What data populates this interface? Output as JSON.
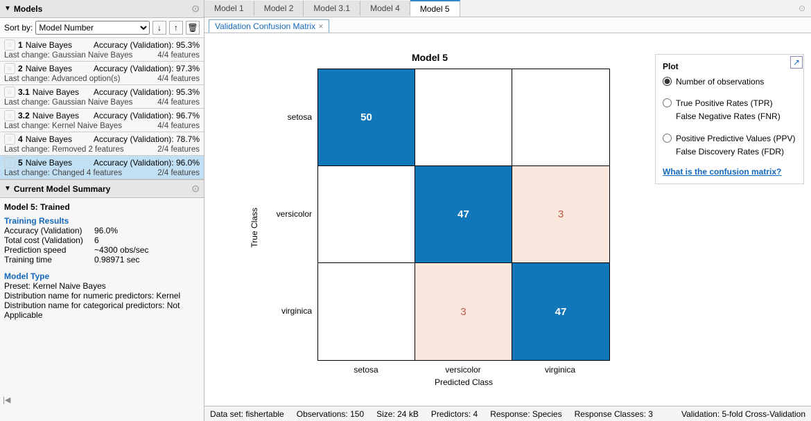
{
  "left": {
    "models_header": "Models",
    "sort_by": "Sort by:",
    "sort_value": "Model Number",
    "items": [
      {
        "num": "1",
        "name": "Naive Bayes",
        "acc": "Accuracy (Validation): 95.3%",
        "lc": "Last change: Gaussian Naive Bayes",
        "feat": "4/4 features",
        "selected": false
      },
      {
        "num": "2",
        "name": "Naive Bayes",
        "acc": "Accuracy (Validation): 97.3%",
        "lc": "Last change: Advanced option(s)",
        "feat": "4/4 features",
        "selected": false
      },
      {
        "num": "3.1",
        "name": "Naive Bayes",
        "acc": "Accuracy (Validation): 95.3%",
        "lc": "Last change: Gaussian Naive Bayes",
        "feat": "4/4 features",
        "selected": false
      },
      {
        "num": "3.2",
        "name": "Naive Bayes",
        "acc": "Accuracy (Validation): 96.7%",
        "lc": "Last change: Kernel Naive Bayes",
        "feat": "4/4 features",
        "selected": false
      },
      {
        "num": "4",
        "name": "Naive Bayes",
        "acc": "Accuracy (Validation): 78.7%",
        "lc": "Last change: Removed 2 features",
        "feat": "2/4 features",
        "selected": false
      },
      {
        "num": "5",
        "name": "Naive Bayes",
        "acc": "Accuracy (Validation): 96.0%",
        "lc": "Last change: Changed 4 features",
        "feat": "2/4 features",
        "selected": true
      }
    ],
    "summary_header": "Current Model Summary",
    "summary_title": "Model 5: Trained",
    "training_results": "Training Results",
    "kv": [
      {
        "k": "Accuracy (Validation)",
        "v": "96.0%"
      },
      {
        "k": "Total cost (Validation)",
        "v": "6"
      },
      {
        "k": "Prediction speed",
        "v": "~4300 obs/sec"
      },
      {
        "k": "Training time",
        "v": "0.98971 sec"
      }
    ],
    "model_type": "Model Type",
    "mt_lines": [
      "Preset: Kernel Naive Bayes",
      "Distribution name for numeric predictors: Kernel",
      "Distribution name for categorical predictors: Not Applicable"
    ]
  },
  "tabs": {
    "docs": [
      "Model 1",
      "Model 2",
      "Model 3.1",
      "Model 4",
      "Model 5"
    ],
    "active_doc": 4,
    "subtab": "Validation Confusion Matrix"
  },
  "plot_panel": {
    "title": "Plot",
    "opt1": "Number of observations",
    "opt2a": "True Positive Rates (TPR)",
    "opt2b": "False Negative Rates (FNR)",
    "opt3a": "Positive Predictive Values (PPV)",
    "opt3b": "False Discovery Rates (FDR)",
    "help": "What is the confusion matrix?"
  },
  "status": {
    "dataset": "Data set: fishertable",
    "obs": "Observations: 150",
    "size": "Size: 24 kB",
    "pred": "Predictors: 4",
    "resp": "Response: Species",
    "classes": "Response Classes: 3",
    "val": "Validation: 5-fold Cross-Validation"
  },
  "chart_data": {
    "type": "heatmap",
    "title": "Model 5",
    "xlabel": "Predicted Class",
    "ylabel": "True Class",
    "row_labels": [
      "setosa",
      "versicolor",
      "virginica"
    ],
    "col_labels": [
      "setosa",
      "versicolor",
      "virginica"
    ],
    "matrix": [
      [
        50,
        0,
        0
      ],
      [
        0,
        47,
        3
      ],
      [
        0,
        3,
        47
      ]
    ]
  }
}
